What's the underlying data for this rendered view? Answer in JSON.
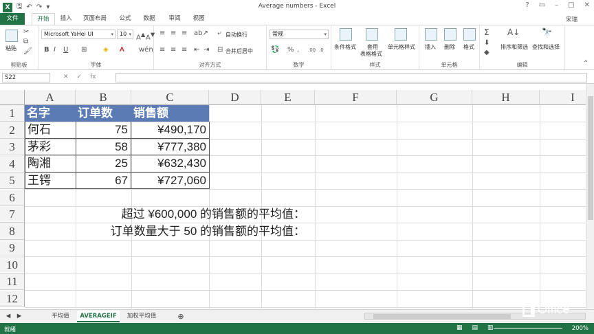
{
  "titlebar": {
    "app_icon": "X",
    "title": "Average numbers - Excel",
    "user": "宋瑞"
  },
  "tabs": [
    "文件",
    "开始",
    "插入",
    "页面布局",
    "公式",
    "数据",
    "审阅",
    "视图"
  ],
  "ribbon": {
    "clipboard": {
      "label": "剪贴板",
      "paste": "粘贴"
    },
    "font": {
      "label": "字体",
      "name": "Microsoft YaHei UI",
      "size": "10"
    },
    "alignment": {
      "label": "对齐方式",
      "wrap": "自动换行",
      "merge": "合并后居中"
    },
    "number": {
      "label": "数字",
      "format": "常规"
    },
    "styles": {
      "label": "样式",
      "cond": "条件格式",
      "table": "套用",
      "table2": "表格格式",
      "cellstyle": "单元格样式"
    },
    "cells": {
      "label": "单元格",
      "insert": "插入",
      "delete": "删除",
      "format": "格式"
    },
    "editing": {
      "label": "编辑",
      "sort": "排序和筛选",
      "find": "查找和选择"
    }
  },
  "formula_bar": {
    "name_box": "S22",
    "fx": "fx"
  },
  "columns": [
    "A",
    "B",
    "C",
    "D",
    "E",
    "F",
    "G",
    "H",
    "I"
  ],
  "rows": [
    "1",
    "2",
    "3",
    "4",
    "5",
    "6",
    "7",
    "8",
    "9",
    "10",
    "11",
    "12"
  ],
  "table": {
    "headers": [
      "名字",
      "订单数",
      "销售额"
    ],
    "rows": [
      [
        "何石",
        "75",
        "¥490,170"
      ],
      [
        "茅彩",
        "58",
        "¥777,380"
      ],
      [
        "陶湘",
        "25",
        "¥632,430"
      ],
      [
        "王锷",
        "67",
        "¥727,060"
      ]
    ]
  },
  "labels": {
    "row7": "超过 ¥600,000 的销售额的平均值：",
    "row8": "订单数量大于 50 的销售额的平均值："
  },
  "sheets": [
    "平均值",
    "AVERAGEIF",
    "加权平均值"
  ],
  "status": {
    "ready": "就绪",
    "zoom": "200%"
  },
  "brand": {
    "office": "Office"
  },
  "colors": {
    "excel_green": "#217346",
    "table_header": "#5b7bb4"
  }
}
